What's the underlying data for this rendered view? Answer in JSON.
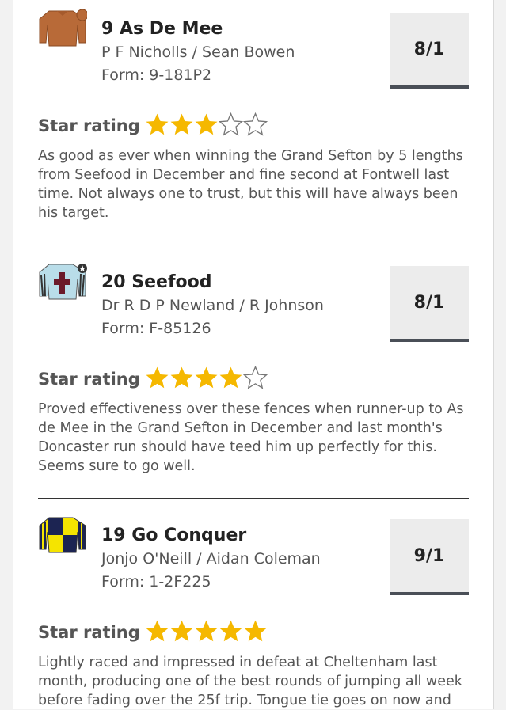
{
  "runners": [
    {
      "name": "9 As De Mee",
      "connections": "P F Nicholls / Sean Bowen",
      "form": "Form: 9-181P2",
      "odds": "8/1",
      "rating_label": "Star rating",
      "stars": 3,
      "max_stars": 5,
      "description": "As good as ever when winning the Grand Sefton by 5 lengths from Seefood in December and fine second at Fontwell last time. Not always one to trust, but this will have always been his target.",
      "silks_icon": "brown-silks-icon"
    },
    {
      "name": "20 Seefood",
      "connections": "Dr R D P Newland / R Johnson",
      "form": "Form: F-85126",
      "odds": "8/1",
      "rating_label": "Star rating",
      "stars": 4,
      "max_stars": 5,
      "description": "Proved effectiveness over these fences when runner-up to As de Mee in the Grand Sefton in December and last month's Doncaster run should have teed him up perfectly for this. Seems sure to go well.",
      "silks_icon": "light-blue-maroon-cross-silks-icon"
    },
    {
      "name": "19 Go Conquer",
      "connections": "Jonjo O'Neill / Aidan Coleman",
      "form": "Form: 1-2F225",
      "odds": "9/1",
      "rating_label": "Star rating",
      "stars": 5,
      "max_stars": 5,
      "description": "Lightly raced and impressed in defeat at Cheltenham last month, producing one of the best rounds of jumping all week before fading over the 25f trip. Tongue tie goes on now and",
      "silks_icon": "yellow-navy-quartered-silks-icon"
    }
  ],
  "colors": {
    "star_filled": "#f5b800",
    "star_empty_stroke": "#777777",
    "odds_bg": "#ececec",
    "odds_underline": "#4a4f57"
  }
}
